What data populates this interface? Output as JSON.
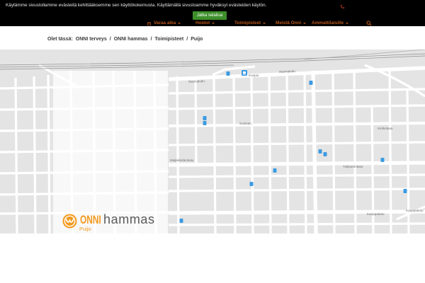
{
  "banner": {
    "message": "Käytämme sivustollamme evästeitä kehittääksemme sen käyttökokemusta. Käyttämällä sivustoamme hyväksyt evästeiden käytön.",
    "accept_label": "Jatka selailua"
  },
  "nav": {
    "items": [
      {
        "label": "Varaa aika",
        "icon": "calendar-icon"
      },
      {
        "label": "Hoidot"
      },
      {
        "label": "Toimipisteet"
      },
      {
        "label": "Meistä Onni"
      },
      {
        "label": "Ammattilaisille"
      }
    ],
    "search_icon": "search-icon",
    "phone_icon": "phone-icon"
  },
  "breadcrumb": {
    "prefix": "Olet tässä:",
    "items": [
      "ONNI terveys",
      "ONNI hammas",
      "Toimipisteet",
      "Puijo"
    ],
    "separator": "/"
  },
  "map": {
    "street_labels": [
      "Asemakatu",
      "Kuopio",
      "Suokatu",
      "Maljalahdenkatu",
      "Tulliportinkatu",
      "Kirkkokatu",
      "Kauppakatu"
    ],
    "marker_icons": [
      "bus-stop-icon",
      "train-station-icon"
    ]
  },
  "logo": {
    "brand": "ONNI",
    "product": "hammas",
    "location": "Puijo",
    "icon": "onni-logo-icon"
  },
  "colors": {
    "brand_orange": "#f39a1e",
    "banner_bg": "#000000",
    "accept_button": "#3d8f2b",
    "nav_text": "#b9561b",
    "map_bg": "#e4e4e4",
    "street": "#ffffff",
    "transit_marker": "#3c9be2"
  }
}
